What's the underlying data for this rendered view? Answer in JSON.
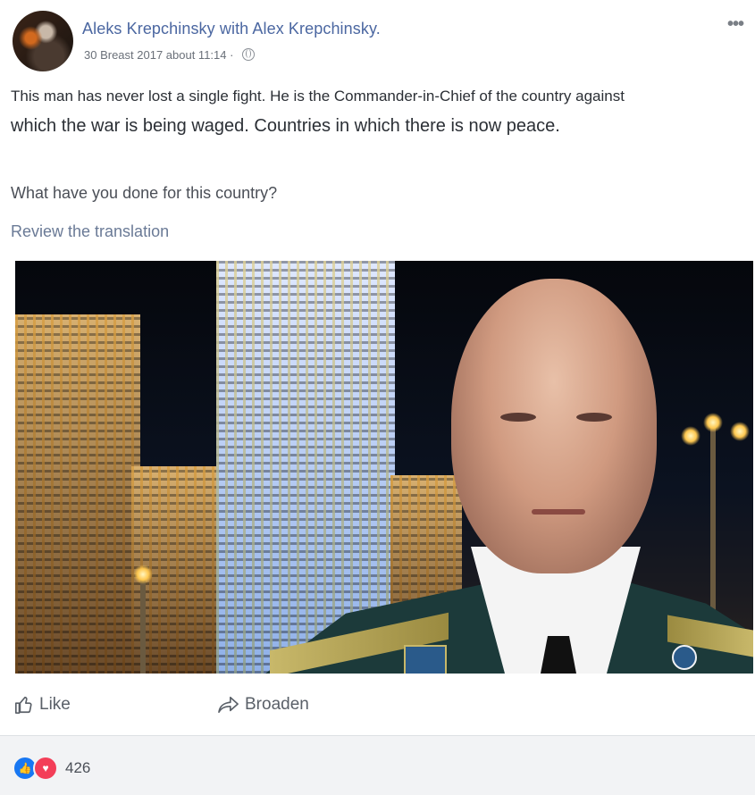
{
  "post": {
    "author": "Aleks Krepchinsky",
    "with_text": "with",
    "tagged": "Alex Krepchinsky.",
    "timestamp": "30 Breast 2017 about 11:14",
    "menu_glyph": "•••",
    "text_line1": "This man has never lost a single fight. He is the Commander-in-Chief of the country against",
    "text_line2": "which the war is being waged. Countries in which there is now peace.",
    "question": "What have you done for this country?",
    "translation_link": "Review the translation"
  },
  "actions": {
    "like_label": "Like",
    "share_label": "Broaden"
  },
  "reactions": {
    "count": "426",
    "types": [
      "like-icon",
      "love-icon"
    ]
  },
  "colors": {
    "link_blue": "#4b67a1",
    "like_blue": "#1877f2",
    "love_red": "#f33e58"
  }
}
